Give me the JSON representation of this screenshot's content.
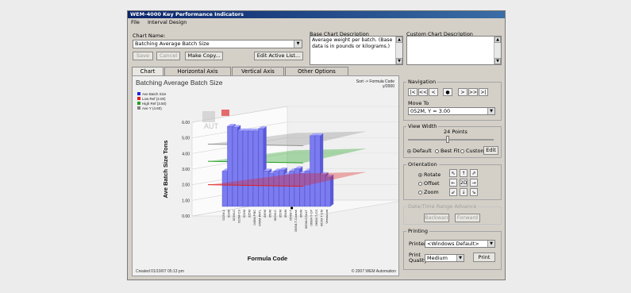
{
  "window": {
    "title": "WEM-4000 Key Performance Indicators"
  },
  "menu": [
    "File",
    "Interval Design"
  ],
  "chart_name": {
    "label": "Chart Name:",
    "value": "Batching Average Batch Size"
  },
  "buttons": {
    "save": "Save",
    "cancel": "Cancel",
    "make_copy": "Make Copy...",
    "edit_active_list": "Edit Active List..."
  },
  "base_desc": {
    "label": "Base Chart Description",
    "text": "Average weight per batch. (Base data is in pounds or kilograms.)"
  },
  "custom_desc": {
    "label": "Custom Chart Description",
    "text": ""
  },
  "tabs": [
    "Chart",
    "Horizontal Axis",
    "Vertical Axis",
    "Other Options"
  ],
  "chart": {
    "title": "Batching Average Batch Size",
    "sort_label": "Sort -> Formula Code",
    "sort_sub": "y/2000",
    "watermark": "AUT",
    "created": "Created 01/19/07 05:13 pm",
    "copyright": "© 2007 WEM Automation"
  },
  "navigation": {
    "title": "Navigation",
    "buttons": [
      "|<",
      "<<",
      "<",
      "●",
      ">",
      ">>",
      ">|"
    ],
    "move_to_label": "Move To",
    "move_to_value": "052M, Y = 3.00"
  },
  "view_width": {
    "title": "View Width",
    "points_label": "24 Points",
    "slider_fraction": 0.45,
    "options": [
      "Default",
      "Best Fit",
      "Custom"
    ],
    "selected": "Default",
    "edit": "Edit"
  },
  "orientation": {
    "title": "Orientation",
    "options": [
      "Rotate",
      "Offset",
      "Zoom"
    ],
    "selected": "Rotate",
    "pad": [
      "⇖",
      "↑",
      "⇗",
      "←",
      "2D",
      "→",
      "⇙",
      "↓",
      "⇘"
    ]
  },
  "date_range": {
    "title": "Date/Time Range Advance",
    "backward": "Backward",
    "forward": "Forward"
  },
  "printing": {
    "title": "Printing",
    "printer_label": "Printer:",
    "printer_value": "<Windows Default>",
    "quality_label": "Print Quality:",
    "quality_value": "Medium",
    "print": "Print"
  },
  "colors": {
    "bar": "#7c7cf0",
    "low_ref": "#e02020",
    "high_ref": "#20a020",
    "avg": "#909090"
  },
  "chart_data": {
    "type": "bar",
    "title": "Batching Average Batch Size",
    "xlabel": "Formula Code",
    "ylabel": "Ave Batch Size Tons",
    "ylim": [
      0,
      6
    ],
    "yticks": [
      "0.00",
      "1.00",
      "2.00",
      "3.00",
      "4.00",
      "5.00",
      "6.00"
    ],
    "legend": [
      {
        "name": "Ave Batch Size",
        "color": "#2020e0"
      },
      {
        "name": "Low Ref (2.00)",
        "color": "#e02020"
      },
      {
        "name": "High Ref (3.50)",
        "color": "#20a020"
      },
      {
        "name": "Ave Y (4.60)",
        "color": "#808080"
      }
    ],
    "reference_lines": {
      "low": 2.0,
      "high": 3.5,
      "avg": 4.6
    },
    "categories": [
      "022M-1",
      "023M",
      "023M-C",
      "023M-CS",
      "024M",
      "025M",
      "049M-PBC",
      "049M-PATL",
      "049M",
      "050M",
      "052M-C",
      "052M",
      "054M",
      "054M-T",
      "055M-T-Coarse",
      "060M",
      "060M-CSALT",
      "060M-T-CP",
      "060M-T-CS",
      "062M-T-CM",
      "Versacoat"
    ],
    "values": [
      3.0,
      6.8,
      6.7,
      6.4,
      6.4,
      6.4,
      6.4,
      6.6,
      3.0,
      2.8,
      3.0,
      3.1,
      2.7,
      3.0,
      3.2,
      2.8,
      3.0,
      6.0,
      6.0,
      2.7,
      2.5
    ]
  }
}
